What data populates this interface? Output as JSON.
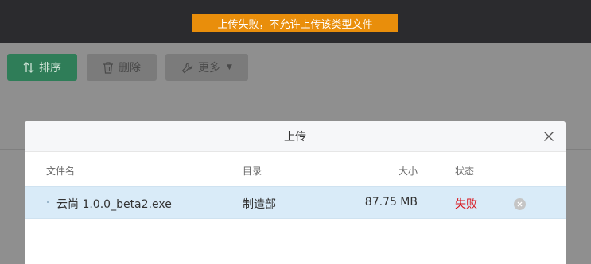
{
  "toast": {
    "message": "上传失败，不允许上传该类型文件",
    "color": "#e98e0b"
  },
  "toolbar": {
    "sort_label": "排序",
    "delete_label": "删除",
    "more_label": "更多"
  },
  "modal": {
    "title": "上传",
    "columns": {
      "name": "文件名",
      "directory": "目录",
      "size": "大小",
      "status": "状态"
    },
    "rows": [
      {
        "name": "云尚 1.0.0_beta2.exe",
        "directory": "制造部",
        "size": "87.75 MB",
        "status": "失败"
      }
    ]
  },
  "colors": {
    "accent": "#2f7d58",
    "fail": "#d9131b",
    "row_highlight": "#d9ebf8"
  }
}
